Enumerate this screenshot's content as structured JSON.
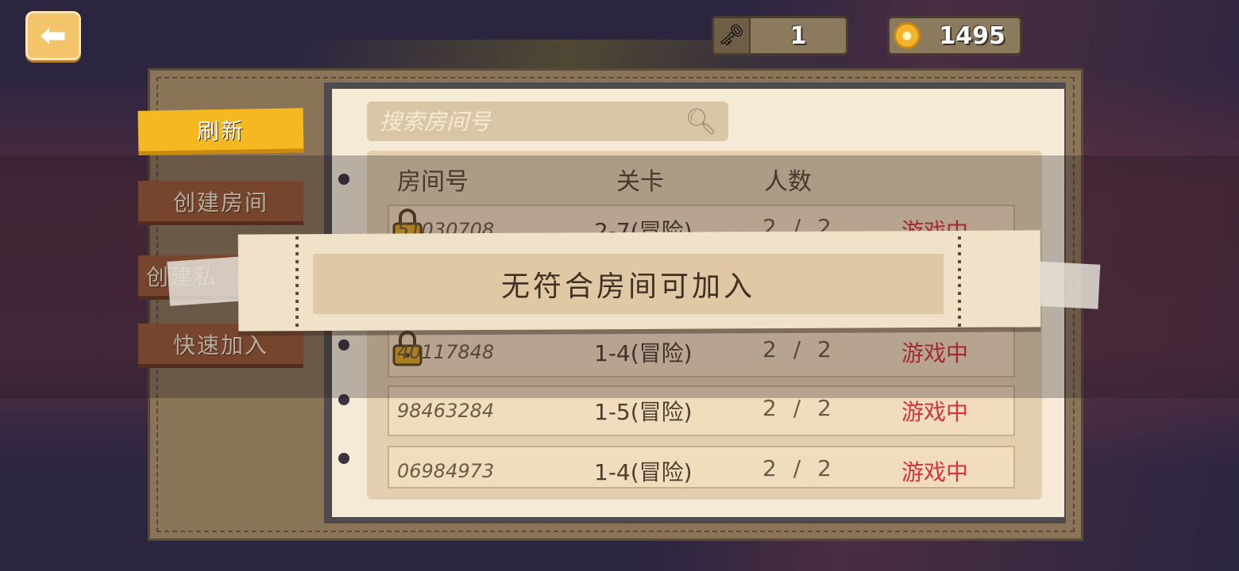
{
  "top_bar": {
    "back_icon": "back-arrow-icon",
    "key_count": "1",
    "coin_count": "1495"
  },
  "side_menu": {
    "refresh": "刷新",
    "create_room": "创建房间",
    "create_private": "创建私",
    "quick_join": "快速加入"
  },
  "search": {
    "placeholder": "搜索房间号"
  },
  "table": {
    "headers": {
      "room": "房间号",
      "stage": "关卡",
      "players": "人数"
    },
    "rows": [
      {
        "room": "51030708",
        "stage": "2-7(冒险)",
        "players": "2 / 2",
        "status": "游戏中",
        "locked": true
      },
      {
        "room": "40117848",
        "stage": "1-4(冒险)",
        "players": "2 / 2",
        "status": "游戏中",
        "locked": true
      },
      {
        "room": "98463284",
        "stage": "1-5(冒险)",
        "players": "2 / 2",
        "status": "游戏中",
        "locked": false
      },
      {
        "room": "06984973",
        "stage": "1-4(冒险)",
        "players": "2 / 2",
        "status": "游戏中",
        "locked": false
      }
    ]
  },
  "notice": {
    "message": "无符合房间可加入"
  },
  "colors": {
    "accent_yellow": "#f5b820",
    "button_brown": "#9a5634",
    "status_red": "#d8323b"
  }
}
